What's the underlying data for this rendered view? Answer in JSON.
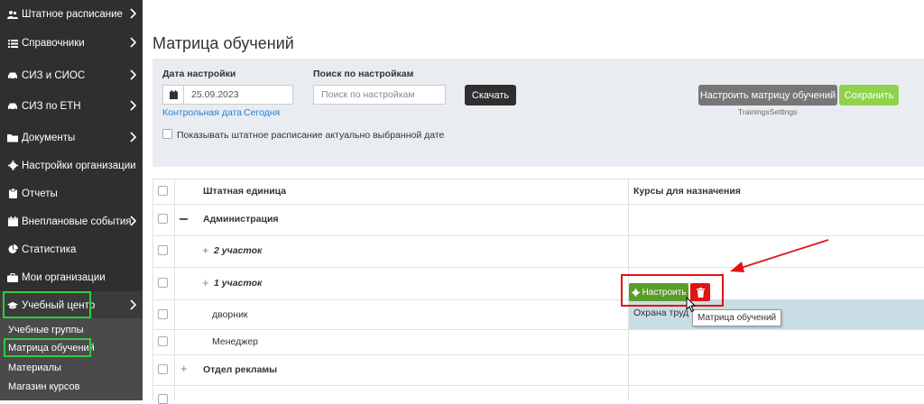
{
  "sidebar": {
    "items": [
      {
        "label": "Штатное расписание",
        "icon": "users-icon",
        "chevron": true
      },
      {
        "label": "Справочники",
        "icon": "list-icon",
        "chevron": true
      },
      {
        "label": "СИЗ и СИОС",
        "icon": "car-icon",
        "chevron": true
      },
      {
        "label": "СИЗ по ЕТН",
        "icon": "car-icon",
        "chevron": true
      },
      {
        "label": "Документы",
        "icon": "folder-icon",
        "chevron": true
      },
      {
        "label": "Настройки организации",
        "icon": "gear-icon",
        "chevron": false
      },
      {
        "label": "Отчеты",
        "icon": "clipboard-icon",
        "chevron": false
      },
      {
        "label": "Внеплановые события",
        "icon": "calendar-icon",
        "chevron": true
      },
      {
        "label": "Статистика",
        "icon": "pie-chart-icon",
        "chevron": false
      },
      {
        "label": "Мои организации",
        "icon": "briefcase-icon",
        "chevron": false
      },
      {
        "label": "Учебный центр",
        "icon": "graduation-cap-icon",
        "chevron": true
      }
    ],
    "submenu": [
      {
        "label": "Учебные группы"
      },
      {
        "label": "Матрица обучений"
      },
      {
        "label": "Материалы"
      },
      {
        "label": "Магазин курсов"
      }
    ]
  },
  "page": {
    "title": "Матрица обучений"
  },
  "filters": {
    "date_label": "Дата настройки",
    "date_value": "25.09.2023",
    "search_label": "Поиск по настройкам",
    "search_placeholder": "Поиск по настройкам",
    "download_button": "Скачать",
    "control_date_link": "Контрольная дата",
    "today_link": "Сегодня",
    "configure_matrix_button": "Настроить матрицу обучений",
    "save_button": "Сохранить",
    "settings_caption": "TrainingsSettings",
    "show_staff_checkbox_label": "Показывать штатное расписание актуально выбранной дате"
  },
  "table": {
    "columns": [
      "Штатная единица",
      "Курсы для назначения"
    ],
    "rows": [
      {
        "name": "Администрация",
        "style": "bold",
        "toggle": "minus",
        "course": ""
      },
      {
        "name": "2 участок",
        "style": "bold-italic",
        "toggle": "plus",
        "course": ""
      },
      {
        "name": "1 участок",
        "style": "bold-italic",
        "toggle": "plus",
        "course": ""
      },
      {
        "name": "дворник",
        "style": "normal",
        "toggle": "",
        "course": "Охрана труд"
      },
      {
        "name": "Менеджер",
        "style": "normal",
        "toggle": "",
        "course": ""
      },
      {
        "name": "Отдел рекламы",
        "style": "bold",
        "toggle": "plus",
        "course": ""
      }
    ],
    "configure_button": "Настроить",
    "tooltip": "Матрица обучений"
  },
  "colors": {
    "sidebar_bg": "#2f2f2f",
    "highlight_green": "#2ecc40",
    "annotation_red": "#e01414",
    "configure_green": "#5a9c2c",
    "save_green": "#8fd24b"
  }
}
